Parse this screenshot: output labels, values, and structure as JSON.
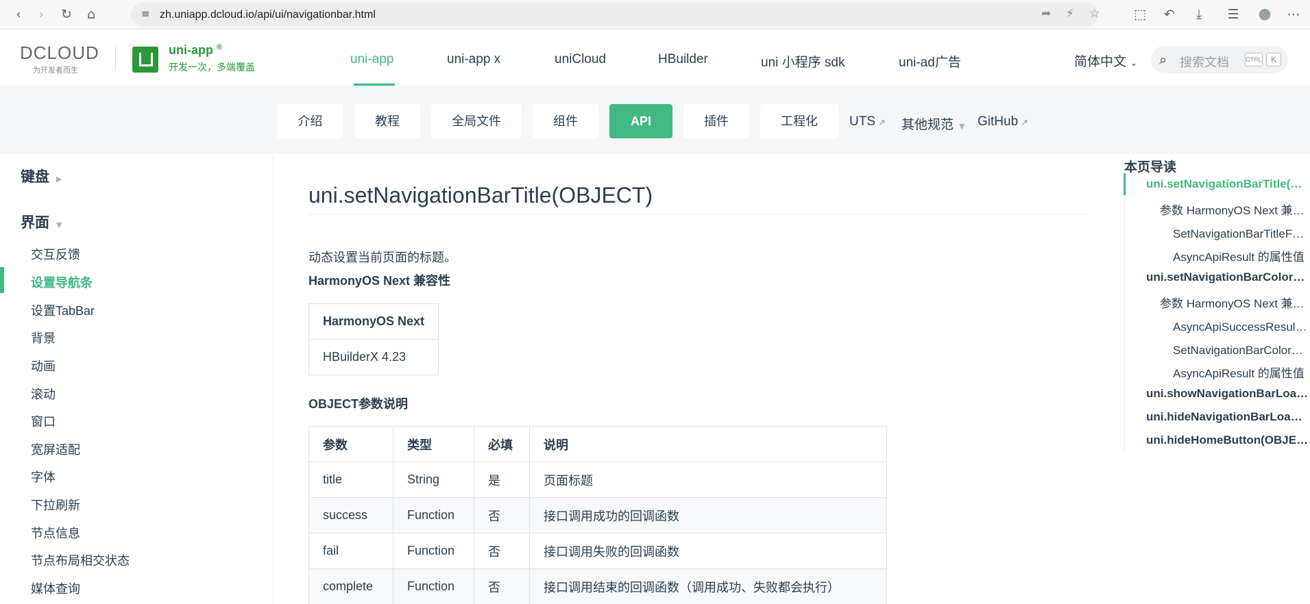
{
  "browser": {
    "url": "zh.uniapp.dcloud.io/api/ui/navigationbar.html"
  },
  "header": {
    "logo_text": "DCLOUD",
    "logo_tagline": "为开发者而生",
    "product_name": "uni-app",
    "product_reg": "®",
    "product_slogan": "开发一次，多端覆盖",
    "nav": [
      "uni-app",
      "uni-app x",
      "uniCloud",
      "HBuilder",
      "uni 小程序 sdk",
      "uni-ad广告"
    ],
    "language": "简体中文",
    "search_placeholder": "搜索文档",
    "kbd_ctrl": "CTRL",
    "kbd_k": "K"
  },
  "subnav": {
    "items": [
      "介绍",
      "教程",
      "全局文件",
      "组件",
      "API",
      "插件",
      "工程化"
    ],
    "links": [
      "UTS",
      "其他规范",
      "GitHub"
    ]
  },
  "sidebar": {
    "group_keyboard": "键盘",
    "group_ui": "界面",
    "items": [
      "交互反馈",
      "设置导航条",
      "设置TabBar",
      "背景",
      "动画",
      "滚动",
      "窗口",
      "宽屏适配",
      "字体",
      "下拉刷新",
      "节点信息",
      "节点布局相交状态",
      "媒体查询"
    ]
  },
  "content": {
    "title": "uni.setNavigationBarTitle(OBJECT)",
    "intro": "动态设置当前页面的标题。",
    "compat_heading": "HarmonyOS Next 兼容性",
    "compat_table": {
      "header": "HarmonyOS Next",
      "value": "HBuilderX 4.23"
    },
    "params_heading": "OBJECT参数说明",
    "params_table": {
      "headers": [
        "参数",
        "类型",
        "必填",
        "说明"
      ],
      "rows": [
        [
          "title",
          "String",
          "是",
          "页面标题"
        ],
        [
          "success",
          "Function",
          "否",
          "接口调用成功的回调函数"
        ],
        [
          "fail",
          "Function",
          "否",
          "接口调用失败的回调函数"
        ],
        [
          "complete",
          "Function",
          "否",
          "接口调用结束的回调函数（调用成功、失败都会执行）"
        ]
      ]
    }
  },
  "toc": {
    "title": "本页导读",
    "items": [
      "uni.setNavigationBarTitle(OBJECT)",
      "参数 HarmonyOS Next 兼容性",
      "SetNavigationBarTitleFail 的属性值",
      "AsyncApiResult 的属性值",
      "uni.setNavigationBarColor(OBJECT)",
      "参数 HarmonyOS Next 兼容性",
      "AsyncApiSuccessResult 的属性值",
      "SetNavigationBarColorFail 的属性值",
      "AsyncApiResult 的属性值",
      "uni.showNavigationBarLoading(OBJECT)",
      "uni.hideNavigationBarLoading(OBJECT)",
      "uni.hideHomeButton(OBJECT)"
    ]
  }
}
